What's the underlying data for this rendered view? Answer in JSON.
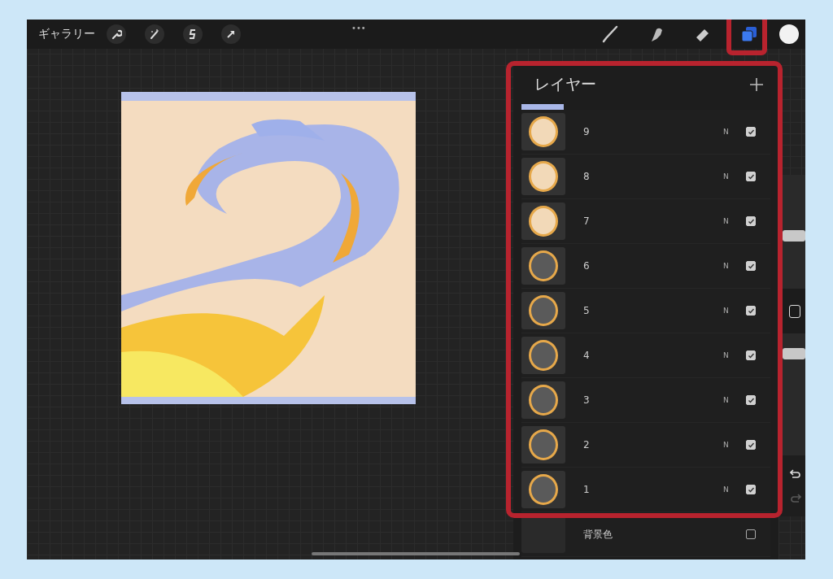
{
  "toolbar": {
    "gallery": "ギャラリー",
    "more": "•••"
  },
  "layers_panel": {
    "title": "レイヤー",
    "layers": [
      {
        "name": "9",
        "blend": "N",
        "visible": true
      },
      {
        "name": "8",
        "blend": "N",
        "visible": true
      },
      {
        "name": "7",
        "blend": "N",
        "visible": true
      },
      {
        "name": "6",
        "blend": "N",
        "visible": true
      },
      {
        "name": "5",
        "blend": "N",
        "visible": true
      },
      {
        "name": "4",
        "blend": "N",
        "visible": true
      },
      {
        "name": "3",
        "blend": "N",
        "visible": true
      },
      {
        "name": "2",
        "blend": "N",
        "visible": true
      },
      {
        "name": "1",
        "blend": "N",
        "visible": true
      }
    ],
    "background": {
      "name": "背景色",
      "visible": false
    }
  },
  "sidebar": {
    "size_slider": {
      "level": 0.46
    },
    "opacity_slider": {
      "level": 0.87
    },
    "redo": {
      "disabled": true
    }
  }
}
